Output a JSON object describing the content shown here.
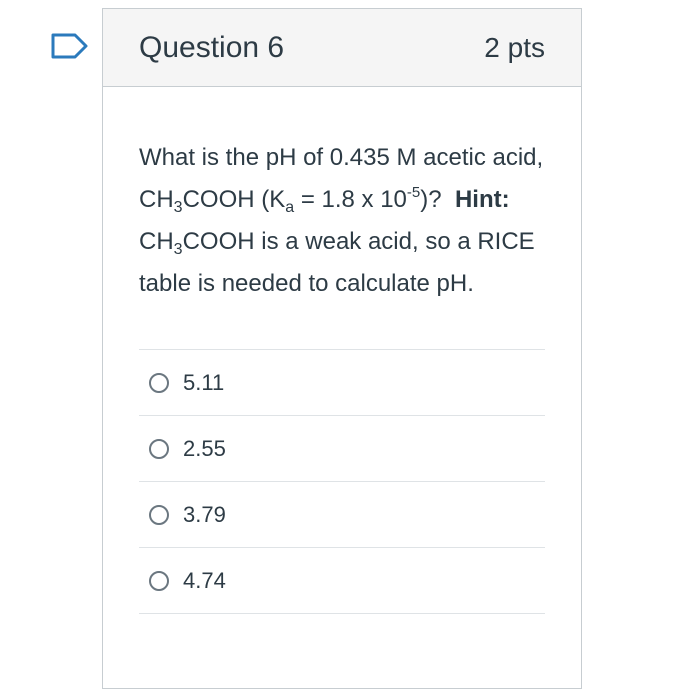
{
  "flag_icon": "bookmark-flag-icon",
  "accent_color": "#2b7abc",
  "question": {
    "title": "Question 6",
    "points": "2 pts",
    "text": {
      "p1": "What is the pH of 0.435 M acetic acid, CH",
      "sub1": "3",
      "p2": "COOH (K",
      "sub2": "a",
      "p3": " = 1.8 x 10",
      "sup1": "-5",
      "p4": ")? ",
      "hint_label": "Hint:",
      "p5": " CH",
      "sub3": "3",
      "p6": "COOH is a weak acid, so a RICE table is needed to calculate pH."
    }
  },
  "answers": [
    {
      "label": "5.11"
    },
    {
      "label": "2.55"
    },
    {
      "label": "3.79"
    },
    {
      "label": "4.74"
    }
  ]
}
